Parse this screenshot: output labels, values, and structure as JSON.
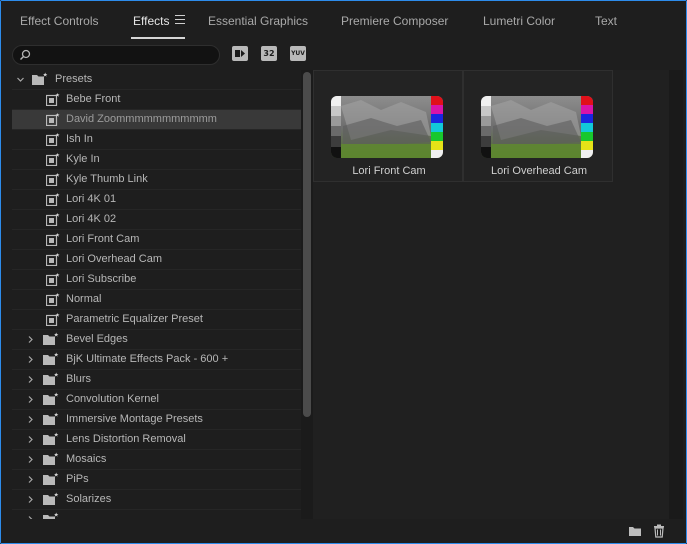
{
  "tabs": [
    {
      "label": "Effect Controls",
      "active": false
    },
    {
      "label": "Effects",
      "active": true
    },
    {
      "label": "Essential Graphics",
      "active": false
    },
    {
      "label": "Premiere Composer",
      "active": false
    },
    {
      "label": "Lumetri Color",
      "active": false
    },
    {
      "label": "Text",
      "active": false
    }
  ],
  "search": {
    "value": "",
    "placeholder": ""
  },
  "filters": [
    {
      "name": "accelerated-effects",
      "glyph": "▶"
    },
    {
      "name": "32-bit-effects",
      "glyph": "32"
    },
    {
      "name": "yuv-effects",
      "glyph": "YUV"
    }
  ],
  "tree": {
    "root": {
      "label": "Presets",
      "expanded": true
    },
    "presets": [
      "Bebe Front",
      "David Zoommmmmmmmmmm",
      "Ish In",
      "Kyle In",
      "Kyle Thumb Link",
      "Lori 4K 01",
      "Lori 4K 02",
      "Lori Front Cam",
      "Lori Overhead Cam",
      "Lori Subscribe",
      "Normal",
      "Parametric Equalizer Preset"
    ],
    "selected_index": 1,
    "folders": [
      "Bevel Edges",
      "BjK Ultimate Effects Pack  - 600 +",
      "Blurs",
      "Convolution Kernel",
      "Immersive Montage Presets",
      "Lens Distortion Removal",
      "Mosaics",
      "PiPs",
      "Solarizes"
    ]
  },
  "preview_cards": [
    {
      "label": "Lori Front Cam"
    },
    {
      "label": "Lori Overhead Cam"
    }
  ],
  "colors": {
    "accent_border": "#2d8ceb",
    "panel_bg": "#1e1e1e",
    "selected_row": "#393939"
  }
}
